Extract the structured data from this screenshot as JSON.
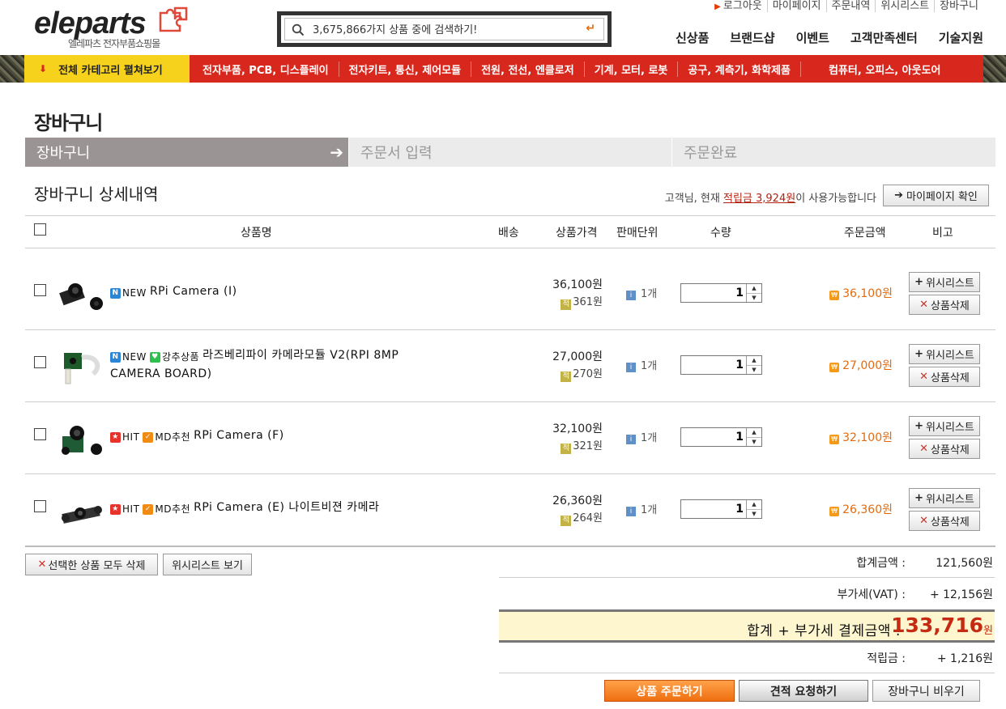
{
  "brand": {
    "logo_text": "eleparts",
    "logo_sub": "엘레파츠 전자부품쇼핑몰"
  },
  "search": {
    "placeholder": "3,675,866가지 상품 중에 검색하기!"
  },
  "top_links": [
    "로그아웃",
    "마이페이지",
    "주문내역",
    "위시리스트",
    "장바구니"
  ],
  "main_nav": [
    "신상품",
    "브랜드샵",
    "이벤트",
    "고객만족센터",
    "기술지원"
  ],
  "category_bar": {
    "all_label": "전체 카테고리 펼쳐보기",
    "items": [
      "전자부품, PCB, 디스플레이",
      "전자키트, 통신, 제어모듈",
      "전원, 전선, 엔클로저",
      "기계, 모터, 로봇",
      "공구, 계측기, 화학제품",
      "컴퓨터, 오피스, 아웃도어"
    ]
  },
  "page_title": "장바구니",
  "steps": [
    "장바구니",
    "주문서 입력",
    "주문완료"
  ],
  "detail_title": "장바구니 상세내역",
  "points_note": {
    "prefix": "고객님, 현재 ",
    "amount": "적립금 3,924원",
    "suffix": "이 사용가능합니다"
  },
  "mypage_button": "마이페이지 확인",
  "columns": {
    "name": "상품명",
    "shipping": "배송",
    "price": "상품가격",
    "unit": "판매단위",
    "qty": "수량",
    "amount": "주문금액",
    "note": "비고"
  },
  "items": [
    {
      "tags": [
        {
          "icon": "N",
          "label": "NEW"
        }
      ],
      "name": "RPi Camera (I)",
      "name2": "",
      "price": "36,100원",
      "points": "361원",
      "unit": "1개",
      "qty": "1",
      "amount": "36,100원"
    },
    {
      "tags": [
        {
          "icon": "N",
          "label": "NEW"
        },
        {
          "icon": "♥",
          "label": "강추상품"
        }
      ],
      "name": "라즈베리파이 카메라모듈 V2(RPI 8MP",
      "name2": "CAMERA BOARD)",
      "price": "27,000원",
      "points": "270원",
      "unit": "1개",
      "qty": "1",
      "amount": "27,000원"
    },
    {
      "tags": [
        {
          "icon": "★",
          "label": "HIT"
        },
        {
          "icon": "✓",
          "label": "MD추천"
        }
      ],
      "name": "RPi Camera (F)",
      "name2": "",
      "price": "32,100원",
      "points": "321원",
      "unit": "1개",
      "qty": "1",
      "amount": "32,100원"
    },
    {
      "tags": [
        {
          "icon": "★",
          "label": "HIT"
        },
        {
          "icon": "✓",
          "label": "MD추천"
        }
      ],
      "name": "RPi Camera (E) 나이트비젼 카메라",
      "name2": "",
      "price": "26,360원",
      "points": "264원",
      "unit": "1개",
      "qty": "1",
      "amount": "26,360원"
    }
  ],
  "row_buttons": {
    "wishlist": "위시리스트",
    "delete": "상품삭제"
  },
  "bottom_buttons": {
    "delete_selected": "선택한 상품 모두 삭제",
    "view_wishlist": "위시리스트 보기"
  },
  "summary": {
    "subtotal_label": "합계금액 :",
    "subtotal": "121,560원",
    "vat_label": "부가세(VAT) :",
    "vat": "+ 12,156원",
    "grand_label": "합계 + 부가세 결제금액 :",
    "grand": "133,716",
    "grand_unit": "원",
    "points_label": "적립금 :",
    "points": "+ 1,216원"
  },
  "actions": {
    "order": "상품 주문하기",
    "quote": "견적 요청하기",
    "empty": "장바구니 비우기"
  },
  "colors": {
    "category_red": "#d8281e",
    "category_yellow": "#f7d21c",
    "accent_orange": "#e26b10",
    "grand_red": "#c52a12"
  }
}
